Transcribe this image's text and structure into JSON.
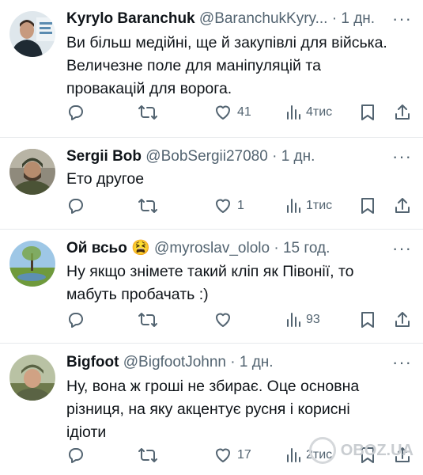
{
  "tweets": [
    {
      "name": "Kyrylo Baranchuk",
      "emoji": "",
      "handle": "@BaranchukKyry...",
      "time": "· 1 дн.",
      "lines": [
        "Ви більш медійні, ще й закупівлі для війська.",
        "Величезне поле для маніпуляцій та",
        "провакацій для ворога."
      ],
      "reply_count": "",
      "retweet_count": "",
      "like_count": "41",
      "views": "4тис"
    },
    {
      "name": "Sergii Bob",
      "emoji": "",
      "handle": "@BobSergii27080",
      "time": "· 1 дн.",
      "lines": [
        "Ето другое"
      ],
      "reply_count": "",
      "retweet_count": "",
      "like_count": "1",
      "views": "1тис"
    },
    {
      "name": "Ой всьо",
      "emoji": "😫",
      "handle": "@myroslav_ololo",
      "time": "· 15 год.",
      "lines": [
        "Ну якщо знімете такий кліп як Півонії, то",
        "мабуть пробачать :)"
      ],
      "reply_count": "",
      "retweet_count": "",
      "like_count": "",
      "views": "93"
    },
    {
      "name": "Bigfoot",
      "emoji": "",
      "handle": "@BigfootJohnn",
      "time": "· 1 дн.",
      "lines": [
        "Ну, вона ж гроші не збирає. Оце основна",
        "різниця, на яку акцентує русня і корисні",
        "ідіоти"
      ],
      "reply_count": "",
      "retweet_count": "",
      "like_count": "17",
      "views": "2тис"
    }
  ],
  "more_glyph": "···",
  "watermark": "OBOZ.UA",
  "icons": [
    "reply-icon",
    "retweet-icon",
    "like-icon",
    "views-icon",
    "bookmark-icon",
    "share-icon"
  ],
  "colors": {
    "text": "#0f1419",
    "secondary": "#536471",
    "divider": "#e6e9ec"
  }
}
